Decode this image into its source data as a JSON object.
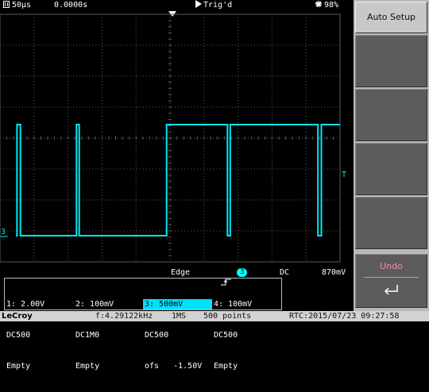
{
  "topbar": {
    "timebase": "50µs",
    "delay": "0.0000s",
    "trigger_status": "Trig'd",
    "battery": "98%"
  },
  "softkeys": {
    "auto_setup": "Auto Setup",
    "undo": "Undo"
  },
  "trace": {
    "color": "#00e8f8",
    "grid_color": "#5a5a5a",
    "high_level": "high",
    "low_level": "low",
    "edges": [
      0.05,
      0.06,
      0.225,
      0.233,
      0.49,
      0.669,
      0.677,
      0.935,
      0.945
    ],
    "channel_marker": "3",
    "trigger_level_marker": "T"
  },
  "trigger_bar": {
    "type": "Edge",
    "source": "3",
    "coupling": "DC",
    "level": "870mV"
  },
  "channels": [
    {
      "head": "1: 2.00V",
      "row1": "DC500",
      "row2": "Empty",
      "active": false
    },
    {
      "head": "2: 100mV",
      "row1": "DC1M0",
      "row2": "Empty",
      "active": false
    },
    {
      "head": "3: 500mV",
      "row1": "DC500",
      "row2": "ofs   -1.50V",
      "active": true
    },
    {
      "head": "4: 100mV",
      "row1": "DC500",
      "row2": "Empty",
      "active": false
    }
  ],
  "bottom": {
    "brand": "LeCroy",
    "frequency": "f:4.29122kHz",
    "sample_rate": "1MS",
    "points": "500 points",
    "rtc": "RTC:2015/07/23 09:27:58"
  },
  "colors": {
    "trace": "#00e8f8",
    "active_channel": "#00e0ff",
    "undo": "#ff7fb5",
    "softkey": "#5c5c5c",
    "bottom_bar": "#d2d2d2"
  }
}
